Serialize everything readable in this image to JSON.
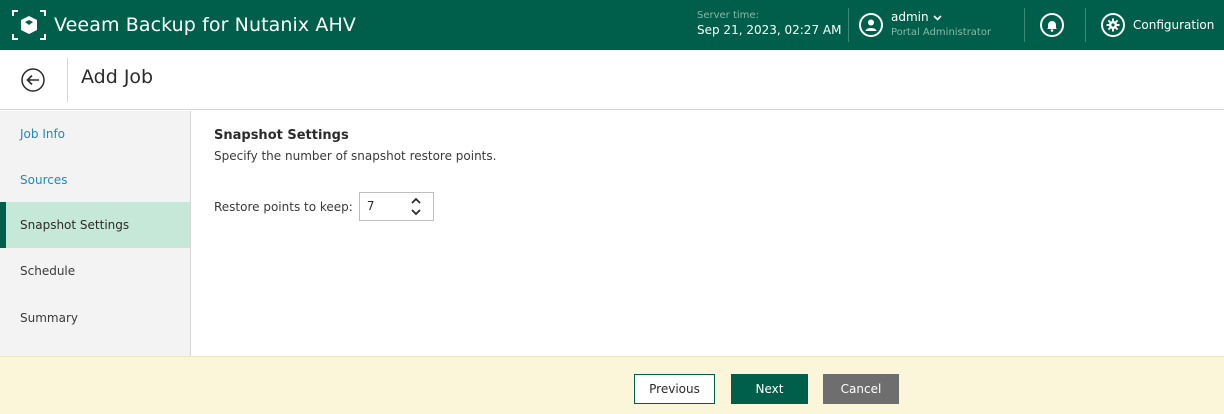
{
  "app": {
    "title": "Veeam Backup for Nutanix AHV"
  },
  "server_time": {
    "label": "Server time:",
    "value": "Sep 21, 2023, 02:27 AM"
  },
  "user": {
    "name": "admin",
    "role": "Portal Administrator"
  },
  "config": {
    "label": "Configuration"
  },
  "page": {
    "title": "Add Job"
  },
  "sidebar": {
    "items": [
      {
        "label": "Job Info",
        "state": "link"
      },
      {
        "label": "Sources",
        "state": "link"
      },
      {
        "label": "Snapshot Settings",
        "state": "active"
      },
      {
        "label": "Schedule",
        "state": "plain"
      },
      {
        "label": "Summary",
        "state": "plain"
      }
    ]
  },
  "section": {
    "title": "Snapshot Settings",
    "description": "Specify the number of snapshot restore points.",
    "restore_points_label": "Restore points to keep:",
    "restore_points_value": "7"
  },
  "footer": {
    "previous_label": "Previous",
    "next_label": "Next",
    "cancel_label": "Cancel"
  },
  "icons": {
    "brand": "veeam-logo-icon",
    "user": "user-icon",
    "dropdown": "chevron-down-icon",
    "bell": "bell-icon",
    "gear": "gear-icon",
    "back": "arrow-left-icon",
    "up": "chevron-up-icon",
    "down": "chevron-down-icon"
  },
  "colors": {
    "topbar": "#005f4b",
    "active_nav": "#c6e8d8",
    "link": "#1a8cc0",
    "footer": "#fbf6da",
    "next_button": "#005f4b",
    "cancel_button": "#6e6e6e"
  }
}
